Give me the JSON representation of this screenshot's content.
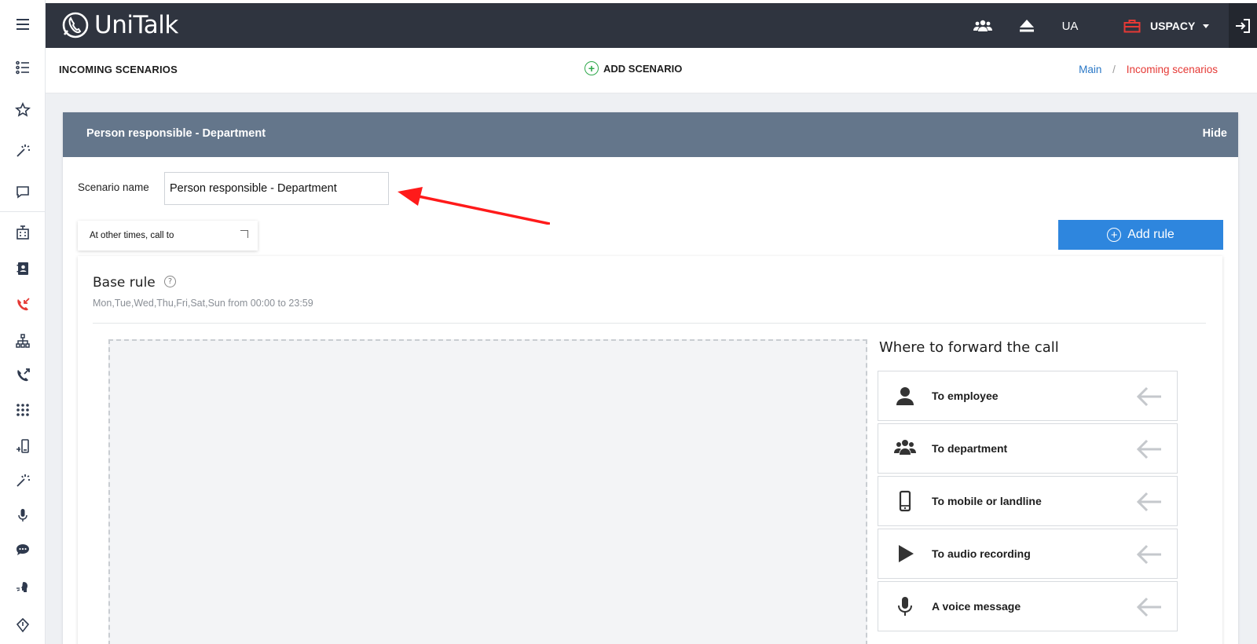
{
  "app": {
    "name": "UniTalk"
  },
  "topbar": {
    "language": "UA",
    "company": "USPACY"
  },
  "page": {
    "title": "INCOMING SCENARIOS",
    "add_scenario": "ADD SCENARIO",
    "breadcrumb": {
      "main": "Main",
      "separator": "/",
      "current": "Incoming scenarios"
    }
  },
  "panel": {
    "title": "Person responsible - Department",
    "hide_label": "Hide",
    "scenario_name_label": "Scenario name",
    "scenario_name_value": "Person responsible - Department",
    "other_times_label": "At other times, call to",
    "add_rule_label": "Add rule"
  },
  "rule": {
    "title": "Base rule",
    "schedule": "Mon,Tue,Wed,Thu,Fri,Sat,Sun from 00:00 to 23:59"
  },
  "forward": {
    "title": "Where to forward the call",
    "items": [
      {
        "label": "To employee",
        "icon": "person-icon"
      },
      {
        "label": "To department",
        "icon": "group-icon"
      },
      {
        "label": "To mobile or landline",
        "icon": "mobile-phone-icon"
      },
      {
        "label": "To audio recording",
        "icon": "play-icon"
      },
      {
        "label": "A voice message",
        "icon": "microphone-icon"
      }
    ]
  },
  "colors": {
    "header_bg": "#2f343f",
    "panel_header_bg": "#64768b",
    "primary_button": "#2e86de",
    "accent_red": "#e53935",
    "link_blue": "#2a78c6",
    "add_green": "#2ea84a"
  }
}
